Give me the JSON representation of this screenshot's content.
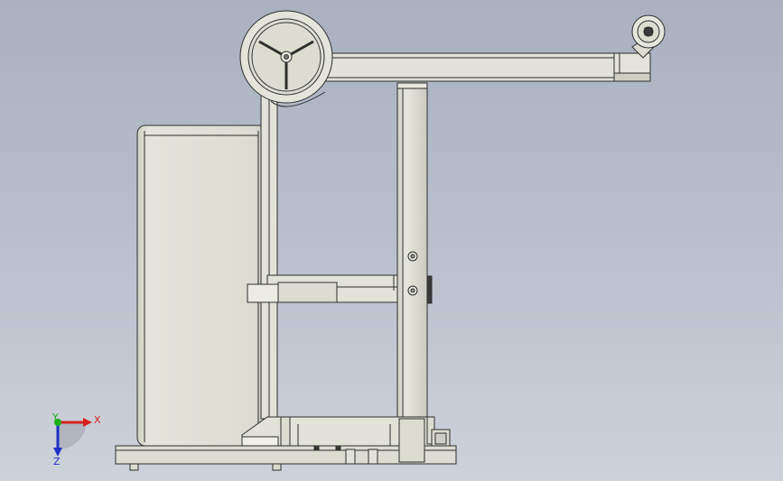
{
  "viewport": {
    "background_top": "#a9b1bf",
    "background_bottom": "#cdd2da",
    "part_fill": "#dcdcd1",
    "part_fill_light": "#e8e8df",
    "part_edge": "#2e2e2e"
  },
  "triad": {
    "x_label": "X",
    "y_label": "Y",
    "z_label": "Z",
    "x_color": "#d62020",
    "y_color": "#18b018",
    "z_color": "#2030c8"
  }
}
